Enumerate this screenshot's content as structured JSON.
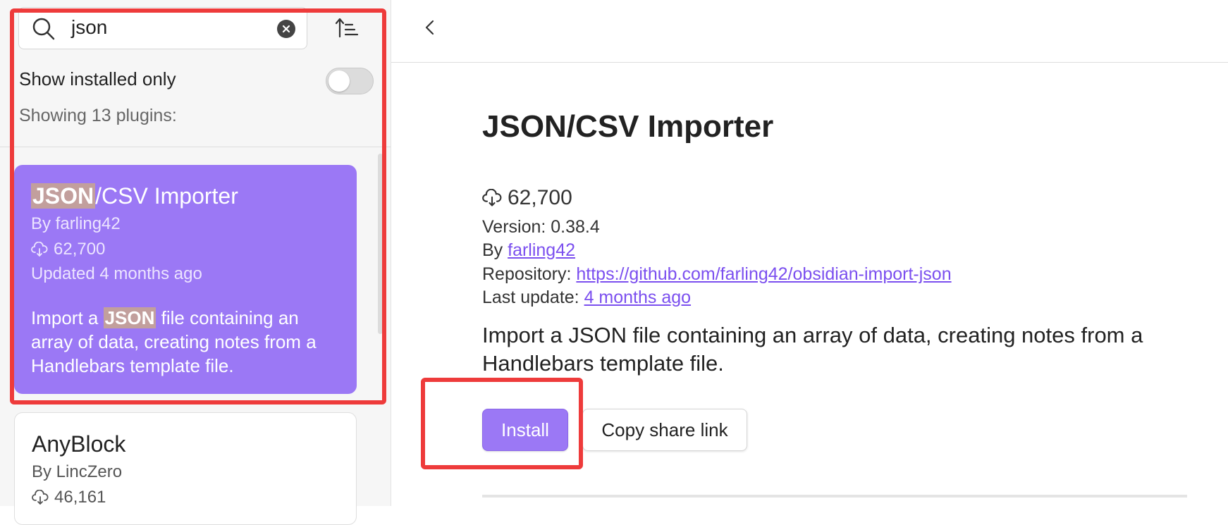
{
  "search": {
    "query": "json",
    "icon": "search-icon",
    "clear_icon": "clear-icon"
  },
  "filters": {
    "show_installed_label": "Show installed only",
    "show_installed_on": false,
    "count_label": "Showing 13 plugins:"
  },
  "plugins": [
    {
      "title_highlight": "JSON",
      "title_rest": "/CSV Importer",
      "author": "By farling42",
      "downloads": "62,700",
      "updated": "Updated 4 months ago",
      "desc_before": "Import a ",
      "desc_highlight": "JSON",
      "desc_after": " file containing an array of data, creating notes from a Handlebars template file.",
      "selected": true
    },
    {
      "title": "AnyBlock",
      "author": "By LincZero",
      "downloads": "46,161",
      "selected": false
    }
  ],
  "detail": {
    "title": "JSON/CSV Importer",
    "downloads": "62,700",
    "version": "Version: 0.38.4",
    "by_label": "By ",
    "author_link": "farling42",
    "repo_label": "Repository: ",
    "repo_link": "https://github.com/farling42/obsidian-import-json",
    "update_label": "Last update: ",
    "update_link": "4 months ago",
    "description": "Import a JSON file containing an array of data, creating notes from a Handlebars template file.",
    "install_label": "Install",
    "share_label": "Copy share link"
  },
  "colors": {
    "accent": "#9b78f5",
    "highlight": "#c29f9d",
    "link": "#7b4fef",
    "annotation": "#ee3b3b"
  }
}
